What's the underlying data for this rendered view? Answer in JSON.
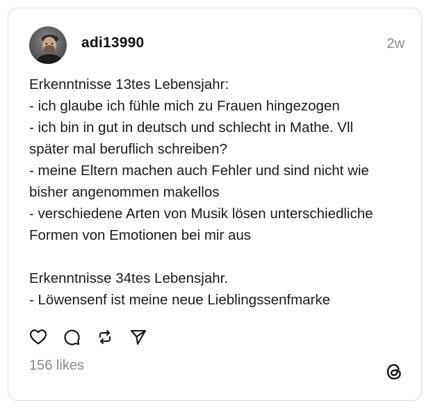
{
  "post": {
    "username": "adi13990",
    "timestamp": "2w",
    "lines": [
      "Erkenntnisse 13tes Lebensjahr:",
      "- ich glaube ich fühle mich zu Frauen hingezogen",
      "- ich bin in gut in deutsch und schlecht in Mathe. Vll",
      "später mal beruflich schreiben?",
      "- meine Eltern machen auch Fehler und sind nicht wie",
      "bisher angenommen makellos",
      "- verschiedene Arten von Musik lösen unterschiedliche",
      "Formen von Emotionen bei mir aus",
      "",
      "Erkenntnisse 34tes Lebensjahr.",
      "- Löwensenf ist meine neue Lieblingssenfmarke"
    ],
    "likes_label": "156 likes"
  },
  "icons": {
    "like": "heart-icon",
    "reply": "comment-icon",
    "repost": "repost-icon",
    "share": "send-icon",
    "brand": "threads-logo-icon"
  },
  "colors": {
    "text": "#1a1a1a",
    "muted": "#8a8a8a",
    "border": "#dcdcdc"
  }
}
